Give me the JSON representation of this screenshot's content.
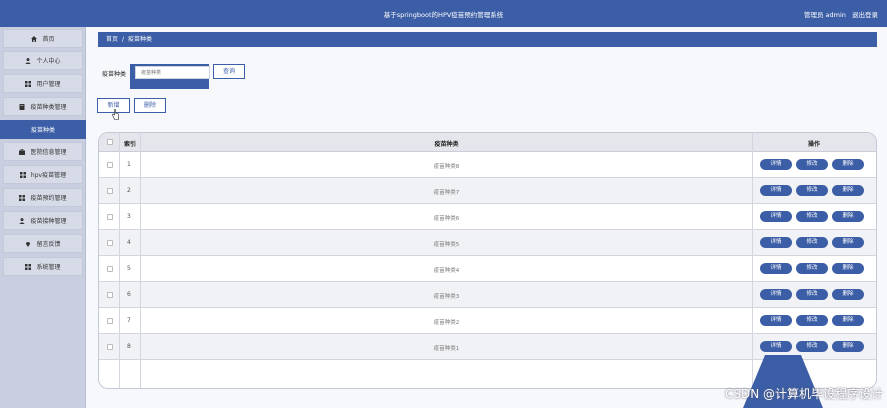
{
  "header": {
    "title": "基于springboot的HPV疫苗预约管理系统",
    "user_label": "管理员 admin",
    "logout": "退出登录"
  },
  "sidebar": {
    "items": [
      {
        "label": "首页",
        "icon": "home-icon"
      },
      {
        "label": "个人中心",
        "icon": "person-icon"
      },
      {
        "label": "用户管理",
        "icon": "grid-icon"
      },
      {
        "label": "疫苗种类管理",
        "icon": "book-icon"
      },
      {
        "label": "疫苗种类",
        "icon": "",
        "active": true
      },
      {
        "label": "医院信息管理",
        "icon": "briefcase-icon"
      },
      {
        "label": "hpv疫苗管理",
        "icon": "grid-icon"
      },
      {
        "label": "疫苗预约管理",
        "icon": "grid-icon"
      },
      {
        "label": "疫苗接种管理",
        "icon": "person-icon"
      },
      {
        "label": "留言反馈",
        "icon": "pin-icon"
      },
      {
        "label": "系统管理",
        "icon": "grid-icon"
      }
    ]
  },
  "breadcrumb": {
    "home": "首页",
    "separator": "/",
    "current": "疫苗种类"
  },
  "search": {
    "label": "疫苗种类",
    "placeholder": "疫苗种类",
    "button": "查询"
  },
  "actions": {
    "add": "新增",
    "delete": "删除"
  },
  "table": {
    "columns": {
      "index": "索引",
      "name": "疫苗种类",
      "ops": "操作"
    },
    "rows": [
      {
        "index": "1",
        "name": "疫苗种类8"
      },
      {
        "index": "2",
        "name": "疫苗种类7"
      },
      {
        "index": "3",
        "name": "疫苗种类6"
      },
      {
        "index": "4",
        "name": "疫苗种类5"
      },
      {
        "index": "5",
        "name": "疫苗种类4"
      },
      {
        "index": "6",
        "name": "疫苗种类3"
      },
      {
        "index": "7",
        "name": "疫苗种类2"
      },
      {
        "index": "8",
        "name": "疫苗种类1"
      }
    ],
    "row_actions": {
      "detail": "详情",
      "edit": "修改",
      "delete": "删除"
    }
  },
  "watermark": "CSDN @计算机毕设程序设计",
  "colors": {
    "primary": "#3c5ea6",
    "sidebar_bg": "#c9cfe0"
  }
}
